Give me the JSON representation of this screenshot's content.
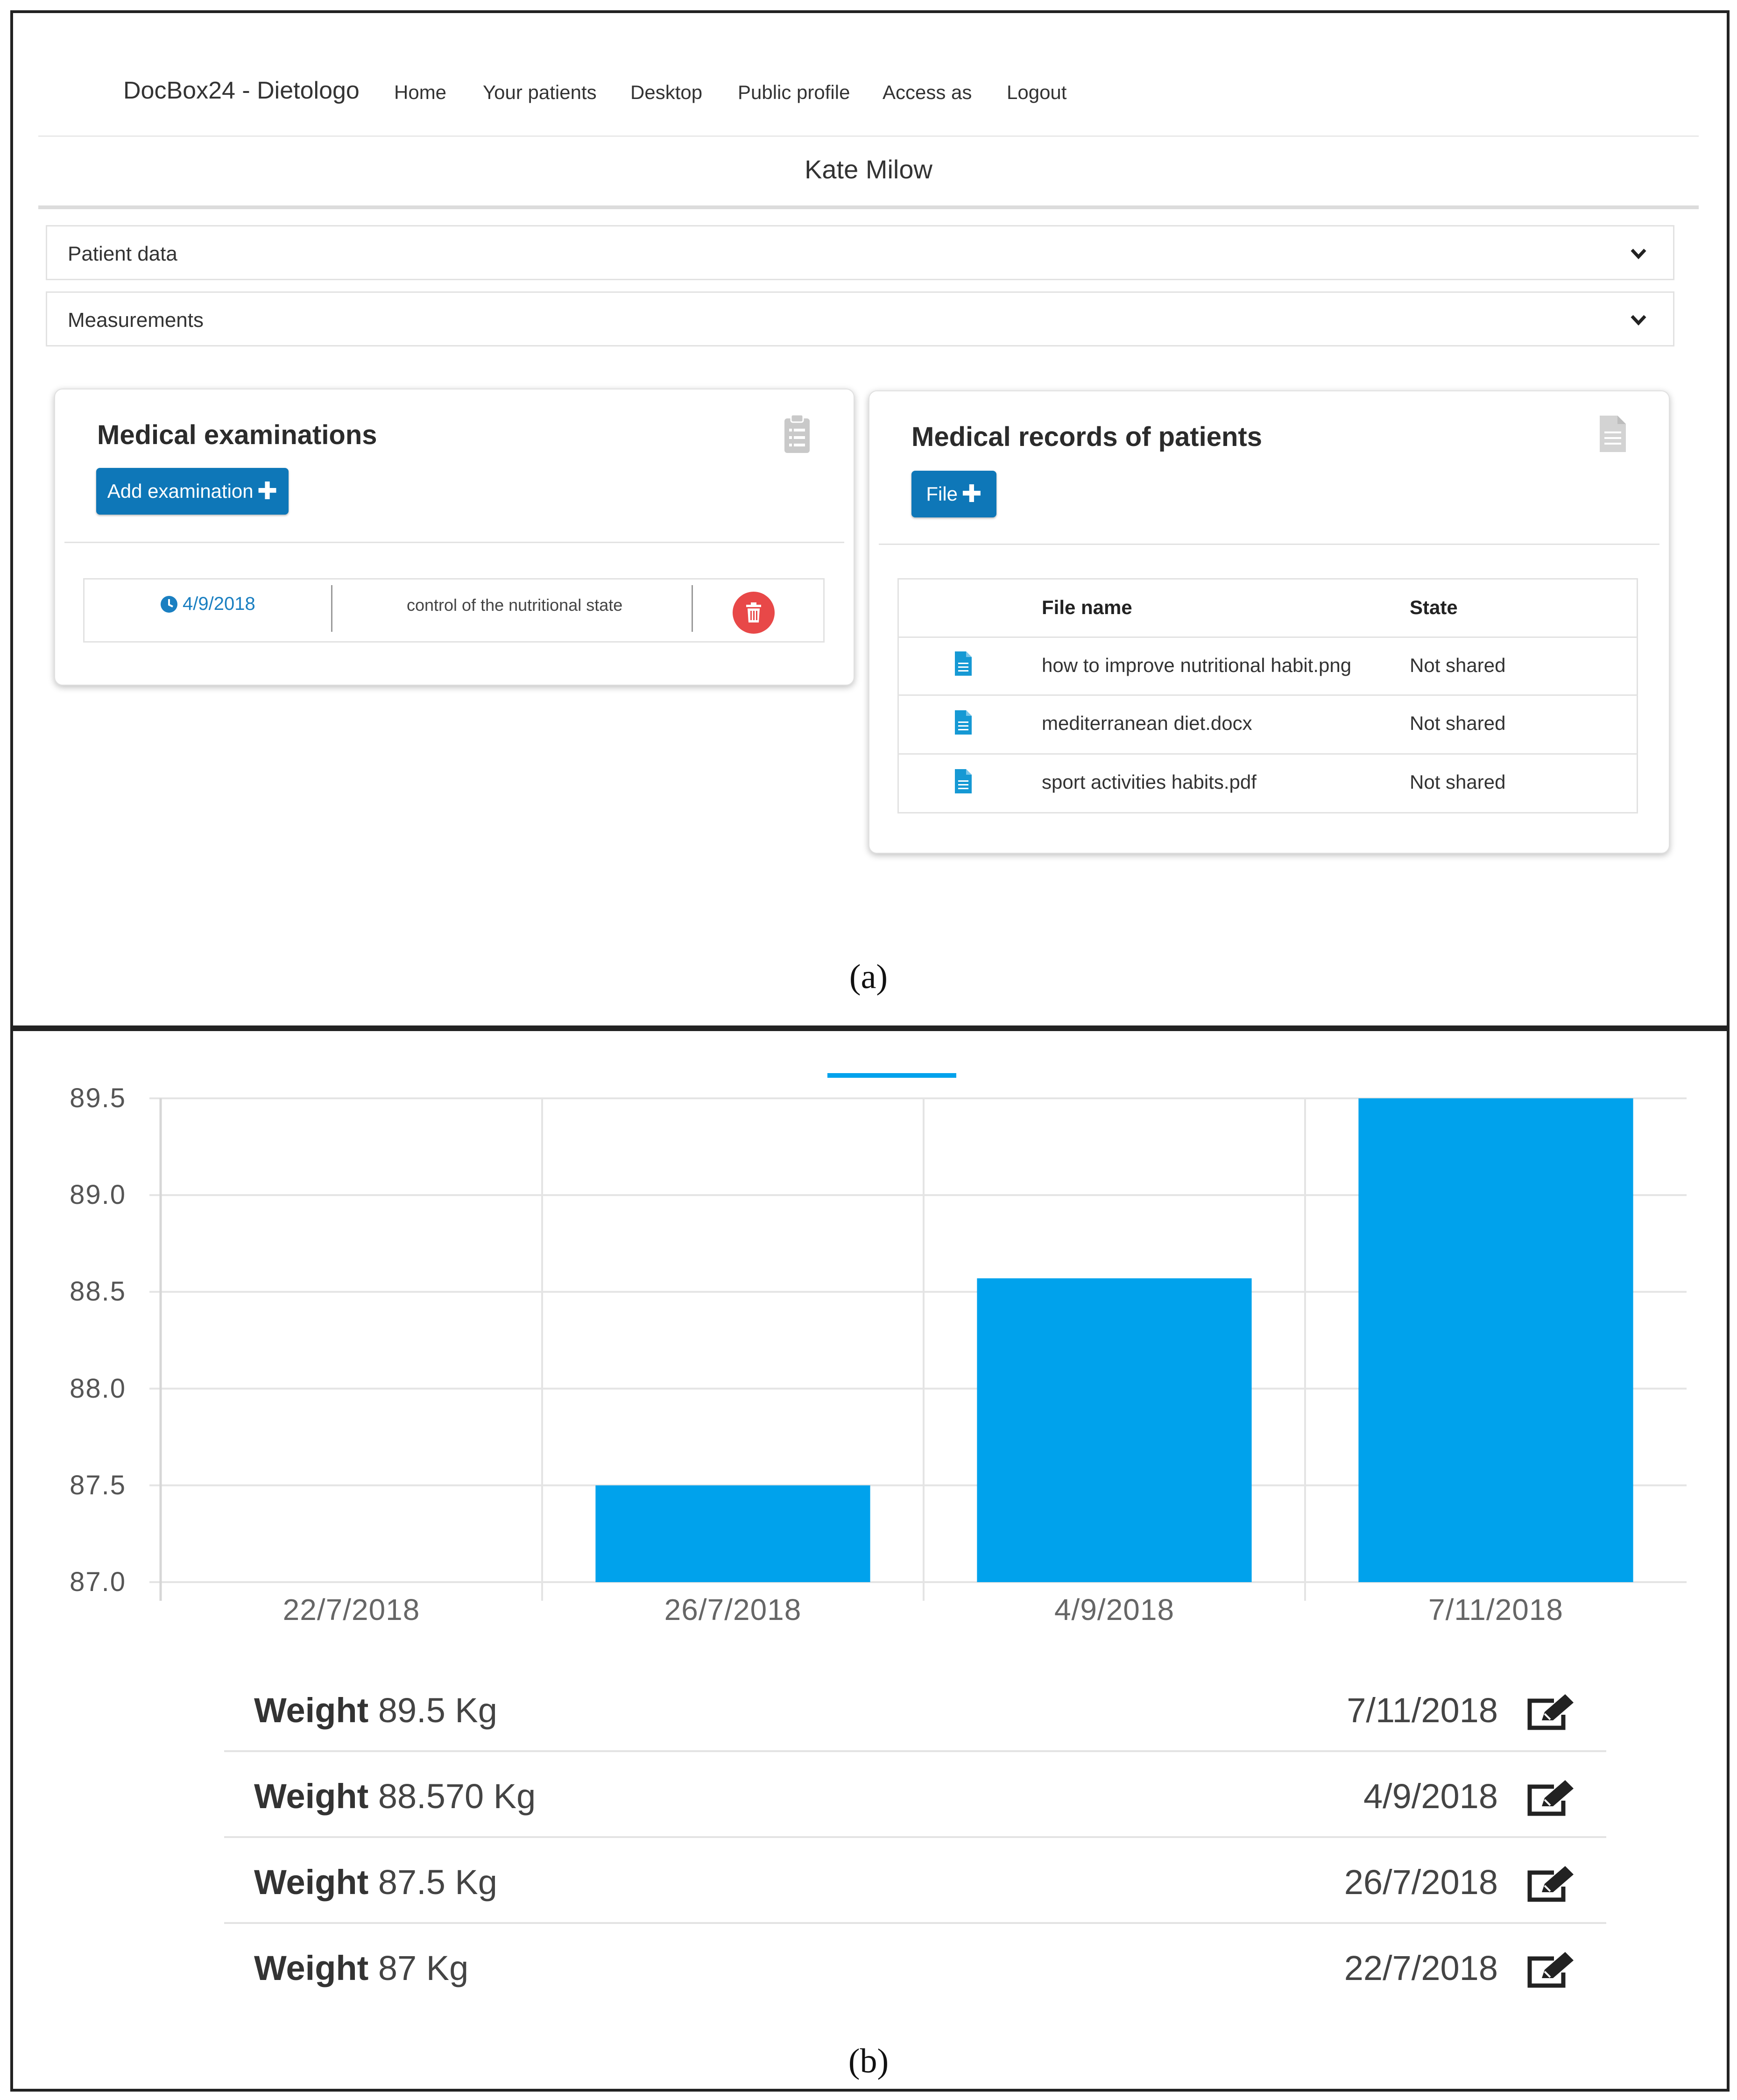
{
  "nav": {
    "brand": "DocBox24 - Dietologo",
    "items": [
      "Home",
      "Your patients",
      "Desktop",
      "Public profile",
      "Access as",
      "Logout"
    ]
  },
  "patient_name": "Kate Milow",
  "accordions": [
    {
      "label": "Patient data"
    },
    {
      "label": "Measurements"
    }
  ],
  "exams_card": {
    "title": "Medical examinations",
    "add_button": "Add examination",
    "rows": [
      {
        "date": "4/9/2018",
        "description": "control of the nutritional state"
      }
    ]
  },
  "records_card": {
    "title": "Medical records of patients",
    "file_button": "File",
    "columns": [
      "File name",
      "State"
    ],
    "rows": [
      {
        "name": "how to improve nutritional habit.png",
        "state": "Not shared"
      },
      {
        "name": "mediterranean diet.docx",
        "state": "Not shared"
      },
      {
        "name": "sport activities habits.pdf",
        "state": "Not shared"
      }
    ]
  },
  "captions": {
    "a": "(a)",
    "b": "(b)"
  },
  "chart_data": {
    "type": "bar",
    "categories": [
      "22/7/2018",
      "26/7/2018",
      "4/9/2018",
      "7/11/2018"
    ],
    "values": [
      87,
      87.5,
      88.57,
      89.5
    ],
    "yticks": [
      "89.5",
      "89.0",
      "88.5",
      "88.0",
      "87.5",
      "87.0"
    ],
    "ylim": [
      87.0,
      89.5
    ],
    "grid": true,
    "color": "#00a2ec"
  },
  "weights": [
    {
      "label": "Weight",
      "value": "89.5 Kg",
      "date": "7/11/2018"
    },
    {
      "label": "Weight",
      "value": "88.570 Kg",
      "date": "4/9/2018"
    },
    {
      "label": "Weight",
      "value": "87.5 Kg",
      "date": "26/7/2018"
    },
    {
      "label": "Weight",
      "value": "87 Kg",
      "date": "22/7/2018"
    }
  ]
}
